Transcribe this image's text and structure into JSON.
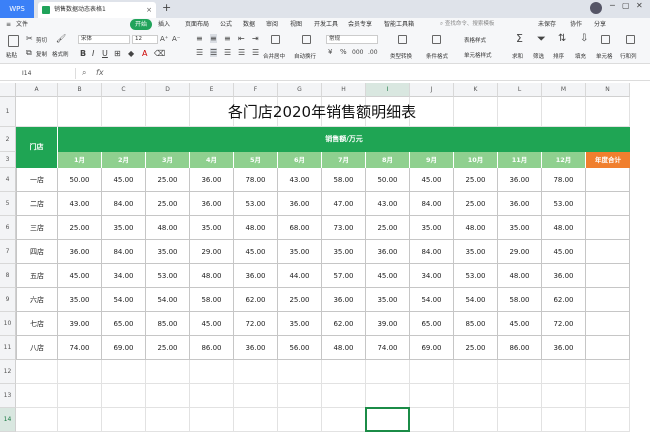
{
  "app": {
    "tab_wps": "WPS",
    "doc_title": "销售数据动态表格1",
    "add_tab": "+",
    "account_status": "未保存"
  },
  "menu": {
    "file": "文件",
    "items": [
      "开始",
      "插入",
      "页面布局",
      "公式",
      "数据",
      "审阅",
      "视图",
      "开发工具",
      "会员专享",
      "智能工具箱"
    ],
    "search_placeholder": "查找命令、搜索模板",
    "collab": "协作",
    "share": "分享"
  },
  "ribbon": {
    "paste": "粘贴",
    "cut": "剪切",
    "copy": "复制",
    "format_painter": "格式刷",
    "font_name": "宋体",
    "font_size": "12",
    "merge_center": "合并居中",
    "wrap": "自动换行",
    "number_format": "常规",
    "cond_format": "条件格式",
    "table_style": "表格样式",
    "cell_style": "单元格样式",
    "type_convert": "类型转换",
    "sum": "求和",
    "filter": "筛选",
    "sort": "排序",
    "fill": "填充",
    "cells": "单元格",
    "rows_cols": "行和列"
  },
  "formula_bar": {
    "cell_ref": "I14",
    "fx": "fx"
  },
  "grid": {
    "columns": [
      "A",
      "B",
      "C",
      "D",
      "E",
      "F",
      "G",
      "H",
      "I",
      "J",
      "K",
      "L",
      "M",
      "N"
    ],
    "selected_column": "I",
    "rows": [
      "1",
      "2",
      "3",
      "4",
      "5",
      "6",
      "7",
      "8",
      "9",
      "10",
      "11",
      "12",
      "13",
      "14"
    ],
    "selected_row": "14"
  },
  "sheet": {
    "title": "各门店2020年销售额明细表",
    "store_header": "门店",
    "sales_header": "销售额/万元",
    "months": [
      "1月",
      "2月",
      "3月",
      "4月",
      "5月",
      "6月",
      "7月",
      "8月",
      "9月",
      "10月",
      "11月",
      "12月"
    ],
    "total_header": "年度合计",
    "stores": [
      {
        "name": "一店",
        "values": [
          "50.00",
          "45.00",
          "25.00",
          "36.00",
          "78.00",
          "43.00",
          "58.00",
          "50.00",
          "45.00",
          "25.00",
          "36.00",
          "78.00"
        ]
      },
      {
        "name": "二店",
        "values": [
          "43.00",
          "84.00",
          "25.00",
          "36.00",
          "53.00",
          "36.00",
          "47.00",
          "43.00",
          "84.00",
          "25.00",
          "36.00",
          "53.00"
        ]
      },
      {
        "name": "三店",
        "values": [
          "25.00",
          "35.00",
          "48.00",
          "35.00",
          "48.00",
          "68.00",
          "73.00",
          "25.00",
          "35.00",
          "48.00",
          "35.00",
          "48.00"
        ]
      },
      {
        "name": "四店",
        "values": [
          "36.00",
          "84.00",
          "35.00",
          "29.00",
          "45.00",
          "35.00",
          "35.00",
          "36.00",
          "84.00",
          "35.00",
          "29.00",
          "45.00"
        ]
      },
      {
        "name": "五店",
        "values": [
          "45.00",
          "34.00",
          "53.00",
          "48.00",
          "36.00",
          "44.00",
          "57.00",
          "45.00",
          "34.00",
          "53.00",
          "48.00",
          "36.00"
        ]
      },
      {
        "name": "六店",
        "values": [
          "35.00",
          "54.00",
          "54.00",
          "58.00",
          "62.00",
          "25.00",
          "36.00",
          "35.00",
          "54.00",
          "54.00",
          "58.00",
          "62.00"
        ]
      },
      {
        "name": "七店",
        "values": [
          "39.00",
          "65.00",
          "85.00",
          "45.00",
          "72.00",
          "35.00",
          "62.00",
          "39.00",
          "65.00",
          "85.00",
          "45.00",
          "72.00"
        ]
      },
      {
        "name": "八店",
        "values": [
          "74.00",
          "69.00",
          "25.00",
          "86.00",
          "36.00",
          "56.00",
          "48.00",
          "74.00",
          "69.00",
          "25.00",
          "86.00",
          "36.00"
        ]
      }
    ]
  },
  "colors": {
    "header_green": "#1fa554",
    "month_green": "#8fd08f",
    "total_orange": "#f07f2e",
    "selection": "#1b8c47"
  }
}
